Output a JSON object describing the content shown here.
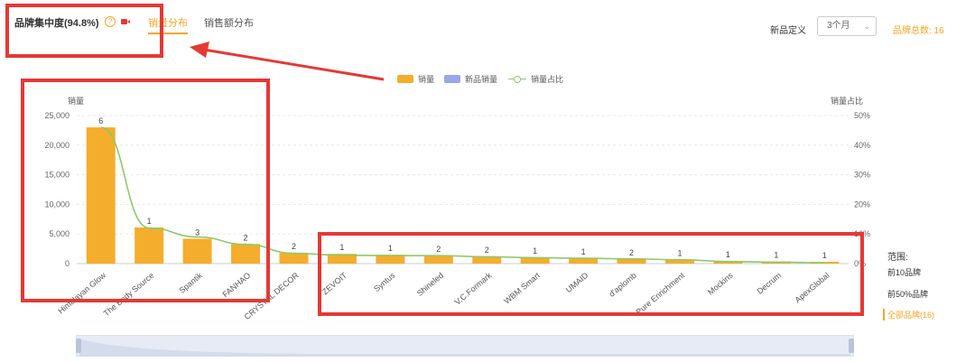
{
  "header": {
    "title": "品牌集中度(94.8%)",
    "tabs": [
      {
        "label": "销量分布",
        "active": true
      },
      {
        "label": "销售额分布",
        "active": false
      }
    ],
    "new_product_label": "新品定义",
    "new_product_select": "3个月",
    "brand_total": "品牌总数: 16"
  },
  "range_filter": {
    "title": "范围:",
    "options": [
      {
        "label": "前10品牌",
        "active": false
      },
      {
        "label": "前50%品牌",
        "active": false
      },
      {
        "label": "全部品牌(16)",
        "active": true
      }
    ]
  },
  "colors": {
    "bar": "#f5ad2c",
    "new_bar": "#9aa7e8",
    "line": "#8ec96b",
    "accent": "#f5a623",
    "annotation": "#e53935"
  },
  "chart_data": {
    "type": "bar",
    "categories": [
      "Himalayan Glow",
      "The Body Source",
      "Spantik",
      "FANHAO",
      "CRYSTAL DECOR",
      "ZEVOIT",
      "Syntus",
      "Shineled",
      "V.C.Formark",
      "WBM Smart",
      "UMAID",
      "d'aplomb",
      "Pure Enrichment",
      "Mockins",
      "Decrum",
      "ApexGlobal"
    ],
    "series": [
      {
        "name": "销量",
        "type": "bar",
        "values": [
          23000,
          6100,
          4200,
          3300,
          1800,
          1650,
          1500,
          1400,
          1200,
          1050,
          900,
          800,
          700,
          450,
          380,
          300
        ]
      },
      {
        "name": "新品销量",
        "type": "bar",
        "values": [
          0,
          0,
          0,
          0,
          0,
          0,
          0,
          0,
          0,
          0,
          0,
          0,
          0,
          0,
          0,
          0
        ]
      },
      {
        "name": "销量占比",
        "type": "line",
        "axis": "right",
        "values": [
          46,
          12,
          9,
          6.5,
          3.5,
          2.8,
          2.7,
          2.7,
          2.3,
          2.0,
          1.8,
          1.6,
          1.3,
          0.7,
          0.5,
          0.3
        ]
      }
    ],
    "bar_labels": [
      6,
      1,
      3,
      2,
      2,
      1,
      1,
      2,
      2,
      1,
      1,
      2,
      1,
      1,
      1,
      1
    ],
    "ylabel": "销量",
    "y2label": "销量占比",
    "ylim": [
      0,
      25000
    ],
    "yticks": [
      "0",
      "5,000",
      "10,000",
      "15,000",
      "20,000",
      "25,000"
    ],
    "y2lim": [
      0,
      50
    ],
    "y2ticks": [
      "0%",
      "10%",
      "20%",
      "30%",
      "40%",
      "50%"
    ],
    "legend": [
      "销量",
      "新品销量",
      "销量占比"
    ],
    "legend_position": "top-center",
    "grid": true
  }
}
